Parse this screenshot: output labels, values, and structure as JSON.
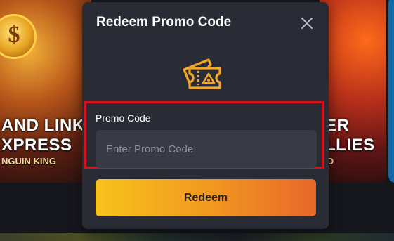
{
  "modal": {
    "title": "Redeem Promo Code",
    "close_icon": "close-icon",
    "ticket_icon": "ticket-icon",
    "field_label": "Promo Code",
    "input_value": "",
    "input_placeholder": "Enter Promo Code",
    "redeem_label": "Redeem"
  },
  "background_tiles": [
    {
      "title_line1": "AND LINK",
      "title_line2": "XPRESS",
      "subtitle": "NGUIN KING"
    },
    {
      "title_line1": "ER",
      "title_line2": "LLIES",
      "subtitle": "O"
    }
  ],
  "colors": {
    "modal_bg": "#2a2c35",
    "input_bg": "#383a45",
    "highlight_border": "#d6111c",
    "accent_icon": "#f5a623",
    "button_gradient_start": "#f7c21b",
    "button_gradient_end": "#e8672a"
  }
}
